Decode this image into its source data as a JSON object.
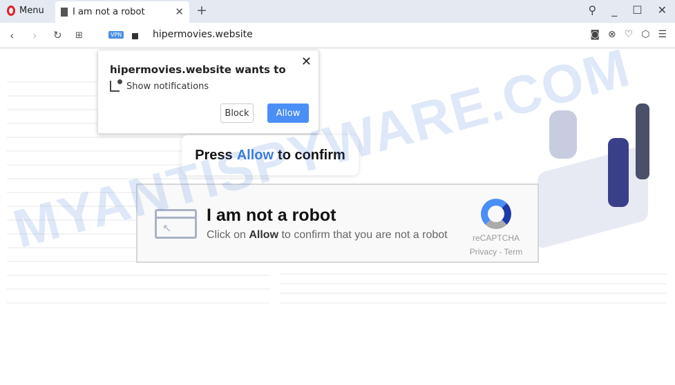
{
  "browser": {
    "menu_label": "Menu",
    "tab_title": "I am not a robot",
    "url": "hipermovies.website",
    "vpn_badge": "VPN"
  },
  "notification_popup": {
    "title": "hipermovies.website wants to",
    "permission": "Show notifications",
    "block_label": "Block",
    "allow_label": "Allow"
  },
  "press_banner": {
    "prefix": "Press",
    "highlight": "Allow",
    "suffix": "to confirm",
    "highlight_color": "#3b7ddd"
  },
  "captcha": {
    "heading": "I am not a robot",
    "sub_prefix": "Click on",
    "sub_bold": "Allow",
    "sub_suffix": "to confirm that you are not a robot",
    "brand": "reCAPTCHA",
    "links": "Privacy - Term"
  },
  "watermark": "MYANTISPYWARE.COM",
  "colors": {
    "allow_button": "#4a8ff5",
    "opera_red": "#e0202a"
  }
}
